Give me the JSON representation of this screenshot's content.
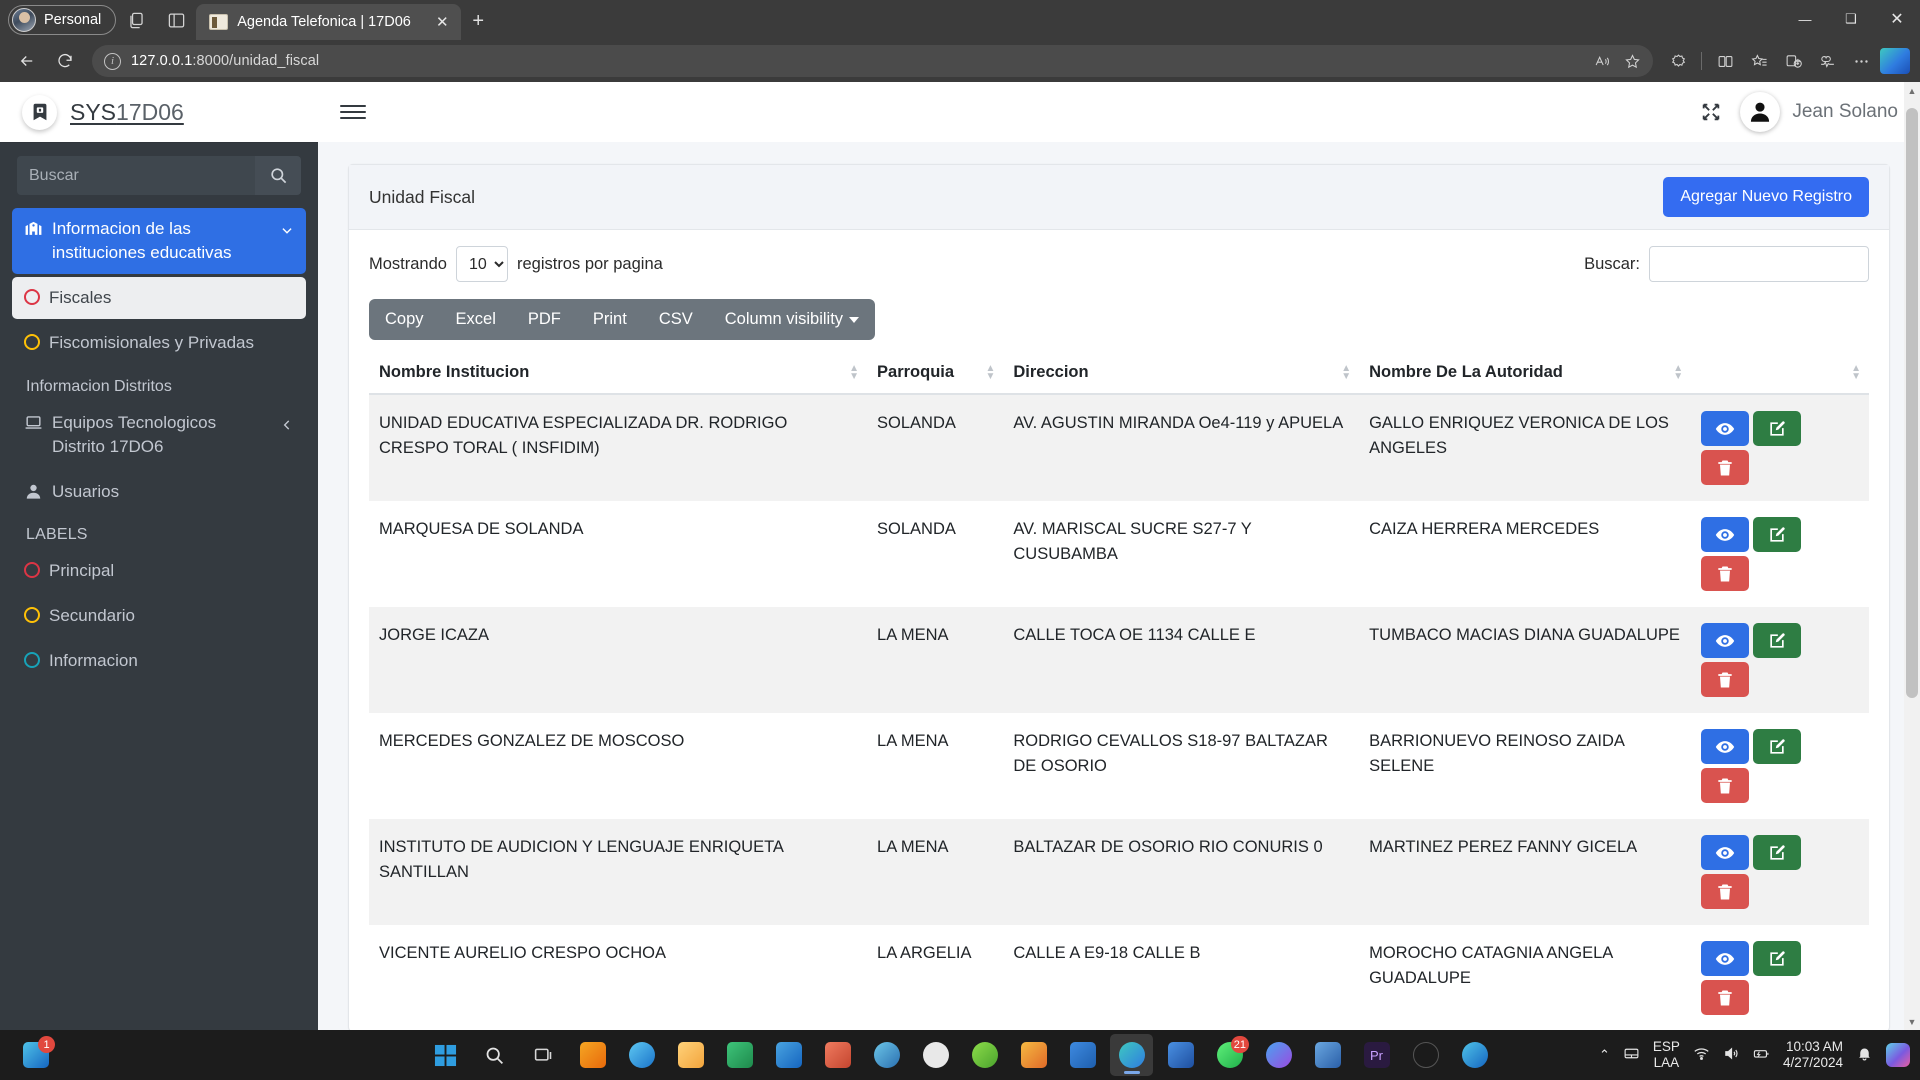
{
  "browser": {
    "profile_label": "Personal",
    "tab_title": "Agenda Telefonica | 17D06",
    "url_host": "127.0.0.1",
    "url_path": ":8000/unidad_fiscal",
    "new_tab_glyph": "+",
    "tab_close_glyph": "✕",
    "win_minimize": "—",
    "win_maximize": "❑",
    "win_close": "✕"
  },
  "sidebar": {
    "brand_strong": "SYS",
    "brand_light": "17D06",
    "search_placeholder": "Buscar",
    "items": [
      {
        "label": "Informacion de las instituciones educativas",
        "icon": "school-icon",
        "state": "active",
        "chevron": true
      },
      {
        "label": "Fiscales",
        "icon": "circle-red-icon",
        "state": "sub-active",
        "ring_color": "#dc3545"
      },
      {
        "label": "Fiscomisionales y Privadas",
        "icon": "circle-yellow-icon",
        "state": "normal",
        "ring_color": "#ffc107"
      }
    ],
    "section_distritos": "Informacion Distritos",
    "items2": [
      {
        "label": "Equipos Tecnologicos Distrito 17DO6",
        "icon": "laptop-icon",
        "chevron_left": true
      },
      {
        "label": "Usuarios",
        "icon": "user-icon"
      }
    ],
    "section_labels": "LABELS",
    "labels": [
      {
        "label": "Principal",
        "icon": "circle-red-icon",
        "ring_color": "#dc3545"
      },
      {
        "label": "Secundario",
        "icon": "circle-yellow-icon",
        "ring_color": "#ffc107"
      },
      {
        "label": "Informacion",
        "icon": "circle-cyan-icon",
        "ring_color": "#17a2b8"
      }
    ]
  },
  "topbar": {
    "menu_icon": "hamburger-icon",
    "expand_icon": "fullscreen-icon",
    "user_name": "Jean Solano"
  },
  "card": {
    "title": "Unidad Fiscal",
    "add_button": "Agregar Nuevo Registro"
  },
  "table_controls": {
    "length_prefix": "Mostrando",
    "length_value": "10",
    "length_suffix": "registros por pagina",
    "filter_label": "Buscar:",
    "filter_value": "",
    "buttons": [
      "Copy",
      "Excel",
      "PDF",
      "Print",
      "CSV"
    ],
    "column_visibility": "Column visibility"
  },
  "table": {
    "columns": [
      "Nombre Institucion",
      "Parroquia",
      "Direccion",
      "Nombre De La Autoridad",
      ""
    ],
    "rows": [
      {
        "nombre": "UNIDAD EDUCATIVA ESPECIALIZADA DR. RODRIGO CRESPO TORAL ( INSFIDIM)",
        "parroquia": "SOLANDA",
        "direccion": "AV. AGUSTIN MIRANDA Oe4-119 y APUELA",
        "autoridad": "GALLO ENRIQUEZ VERONICA DE LOS ANGELES"
      },
      {
        "nombre": "MARQUESA DE SOLANDA",
        "parroquia": "SOLANDA",
        "direccion": "AV. MARISCAL SUCRE S27-7 Y CUSUBAMBA",
        "autoridad": "CAIZA HERRERA MERCEDES"
      },
      {
        "nombre": "JORGE ICAZA",
        "parroquia": "LA MENA",
        "direccion": "CALLE TOCA OE 1134 CALLE E",
        "autoridad": "TUMBACO MACIAS DIANA GUADALUPE"
      },
      {
        "nombre": "MERCEDES GONZALEZ DE MOSCOSO",
        "parroquia": "LA MENA",
        "direccion": "RODRIGO CEVALLOS S18-97 BALTAZAR DE OSORIO",
        "autoridad": "BARRIONUEVO REINOSO ZAIDA SELENE"
      },
      {
        "nombre": "INSTITUTO DE AUDICION Y LENGUAJE ENRIQUETA SANTILLAN",
        "parroquia": "LA MENA",
        "direccion": "BALTAZAR DE OSORIO RIO CONURIS 0",
        "autoridad": "MARTINEZ PEREZ FANNY GICELA"
      },
      {
        "nombre": "VICENTE AURELIO CRESPO OCHOA",
        "parroquia": "LA ARGELIA",
        "direccion": "CALLE A E9-18 CALLE B",
        "autoridad": "MOROCHO CATAGNIA ANGELA GUADALUPE"
      }
    ],
    "action_icons": {
      "view": "eye-icon",
      "edit": "pencil-square-icon",
      "delete": "trash-icon"
    }
  },
  "taskbar": {
    "start_badge": "1",
    "whatsapp_badge": "21",
    "language": {
      "line1": "ESP",
      "line2": "LAA"
    },
    "clock": {
      "time": "10:03 AM",
      "date": "4/27/2024"
    }
  },
  "colors": {
    "accent": "#346cf1",
    "sidebar_bg": "#343a40",
    "danger": "#d9534f",
    "success": "#2e7d43",
    "toolbar_gray": "#6c757d"
  }
}
